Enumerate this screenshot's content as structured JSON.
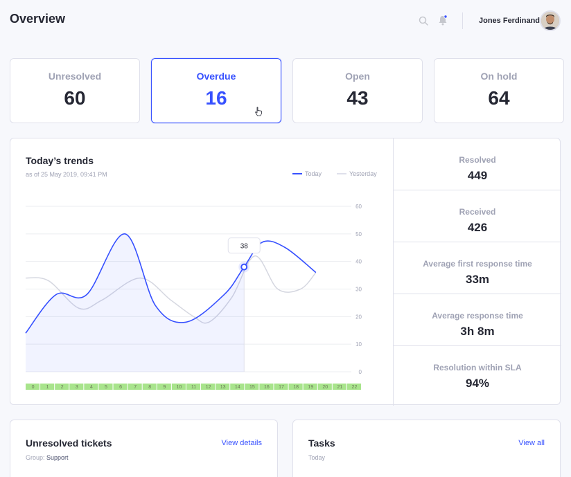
{
  "header": {
    "title": "Overview",
    "user_name": "Jones Ferdinand"
  },
  "stat_cards": [
    {
      "label": "Unresolved",
      "value": "60"
    },
    {
      "label": "Overdue",
      "value": "16"
    },
    {
      "label": "Open",
      "value": "43"
    },
    {
      "label": "On hold",
      "value": "64"
    }
  ],
  "trends": {
    "title": "Today’s trends",
    "subtitle": "as of 25 May 2019, 09:41 PM",
    "legend_today": "Today",
    "legend_yesterday": "Yesterday",
    "tooltip_value": "38"
  },
  "chart_data": {
    "type": "line",
    "x": [
      0,
      1,
      2,
      3,
      4,
      5,
      6,
      7,
      8,
      9,
      10,
      11,
      12,
      13,
      14,
      15,
      16,
      17,
      18,
      19,
      20,
      21,
      22
    ],
    "x_tick_labels": [
      "0",
      "1",
      "2",
      "3",
      "4",
      "5",
      "6",
      "7",
      "8",
      "9",
      "10",
      "11",
      "12",
      "13",
      "14",
      "15",
      "16",
      "17",
      "18",
      "19",
      "20",
      "21",
      "22"
    ],
    "y_ticks": [
      0,
      10,
      20,
      30,
      40,
      50,
      60
    ],
    "ylim": [
      0,
      60
    ],
    "series": [
      {
        "name": "Today",
        "color": "#3751ff",
        "points": [
          [
            0,
            14
          ],
          [
            2,
            28
          ],
          [
            4,
            28
          ],
          [
            6.5,
            50
          ],
          [
            8.5,
            24
          ],
          [
            10.5,
            18
          ],
          [
            13,
            28
          ],
          [
            14.3,
            38
          ],
          [
            15.5,
            47
          ],
          [
            17,
            45
          ],
          [
            19,
            36
          ]
        ]
      },
      {
        "name": "Yesterday",
        "color": "#dfe0eb",
        "points": [
          [
            0,
            34
          ],
          [
            1.5,
            33
          ],
          [
            3.5,
            23
          ],
          [
            5,
            26
          ],
          [
            7.5,
            34
          ],
          [
            9.5,
            26
          ],
          [
            11,
            20
          ],
          [
            12,
            18
          ],
          [
            13.5,
            27
          ],
          [
            15,
            42
          ],
          [
            16.5,
            30
          ],
          [
            18,
            30
          ],
          [
            19,
            36
          ]
        ]
      }
    ],
    "highlight": {
      "x": 14.3,
      "y": 38
    },
    "grid": true
  },
  "side_stats": [
    {
      "label": "Resolved",
      "value": "449"
    },
    {
      "label": "Received",
      "value": "426"
    },
    {
      "label": "Average first response time",
      "value": "33m"
    },
    {
      "label": "Average response time",
      "value": "3h 8m"
    },
    {
      "label": "Resolution within SLA",
      "value": "94%"
    }
  ],
  "unresolved": {
    "title": "Unresolved tickets",
    "link": "View details",
    "group_label": "Group:",
    "group_value": "Support"
  },
  "tasks": {
    "title": "Tasks",
    "link": "View all",
    "sub": "Today"
  },
  "colors": {
    "accent": "#3751ff",
    "muted": "#9fa2b4",
    "border": "#dfe0eb"
  }
}
